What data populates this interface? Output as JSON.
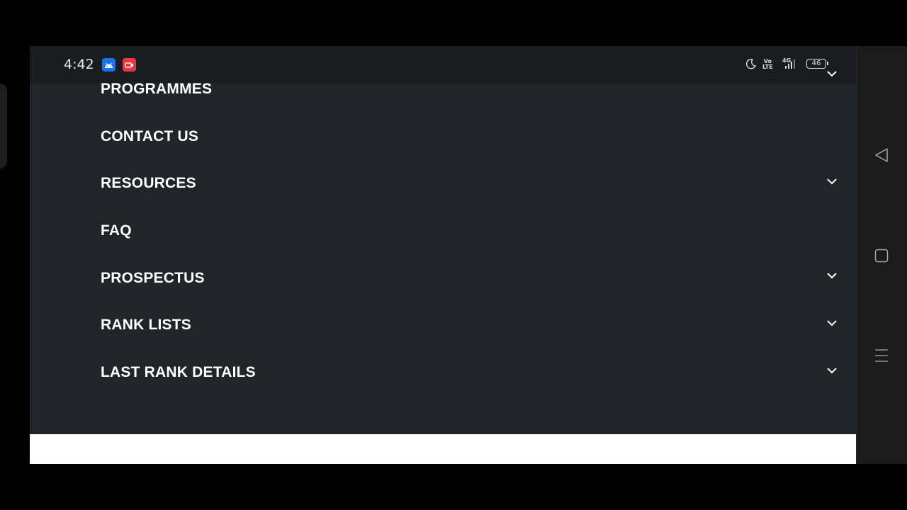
{
  "status_bar": {
    "time": "4:42",
    "icons": [
      "android-app-icon",
      "screen-recorder-icon",
      "moon-icon",
      "volte-icon",
      "signal-icon",
      "battery-icon"
    ],
    "volte_line1": "Vo",
    "volte_line2": "LTE",
    "network": "4G",
    "battery": "46"
  },
  "menu": {
    "items": [
      {
        "label": "PROGRAMMES",
        "has_dropdown": true
      },
      {
        "label": "CONTACT US",
        "has_dropdown": false
      },
      {
        "label": "RESOURCES",
        "has_dropdown": true
      },
      {
        "label": "FAQ",
        "has_dropdown": false
      },
      {
        "label": "PROSPECTUS",
        "has_dropdown": true
      },
      {
        "label": "RANK LISTS",
        "has_dropdown": true
      },
      {
        "label": "LAST RANK DETAILS",
        "has_dropdown": true
      }
    ]
  },
  "nav_bar": {
    "buttons": [
      "back-icon",
      "home-icon",
      "recents-icon"
    ]
  },
  "colors": {
    "menu_background": "#212529",
    "menu_text": "#ffffff",
    "status_bar": "#1a1c1f",
    "page_background": "#000000"
  }
}
